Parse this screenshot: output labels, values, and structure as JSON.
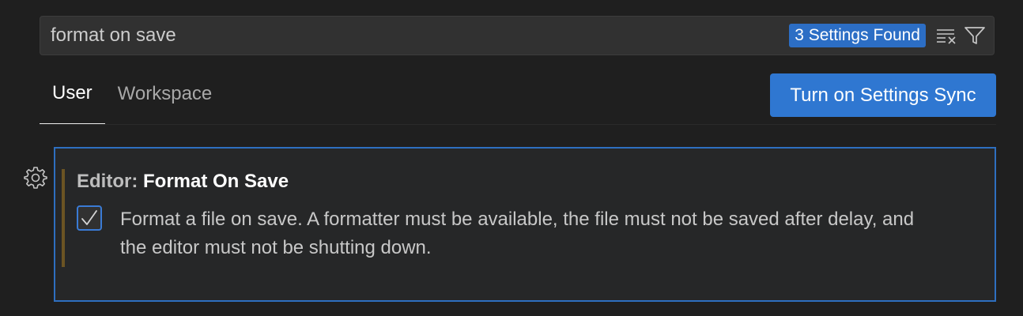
{
  "search": {
    "value": "format on save",
    "results_badge": "3 Settings Found",
    "clear_icon": "clear-filter-icon",
    "filter_icon": "filter-icon"
  },
  "tabs": [
    {
      "label": "User",
      "active": true
    },
    {
      "label": "Workspace",
      "active": false
    }
  ],
  "sync_button": {
    "label": "Turn on Settings Sync"
  },
  "setting": {
    "category": "Editor: ",
    "name": "Format On Save",
    "checked": true,
    "description": "Format a file on save. A formatter must be available, the file must not be saved after delay, and the editor must not be shutting down.",
    "gear_icon": "gear-icon"
  },
  "colors": {
    "background": "#1f1f1f",
    "accent": "#2f77d1",
    "badge": "#2c6ec5",
    "focus_border": "#2e6fc0",
    "modified_indicator": "#6b5423"
  }
}
